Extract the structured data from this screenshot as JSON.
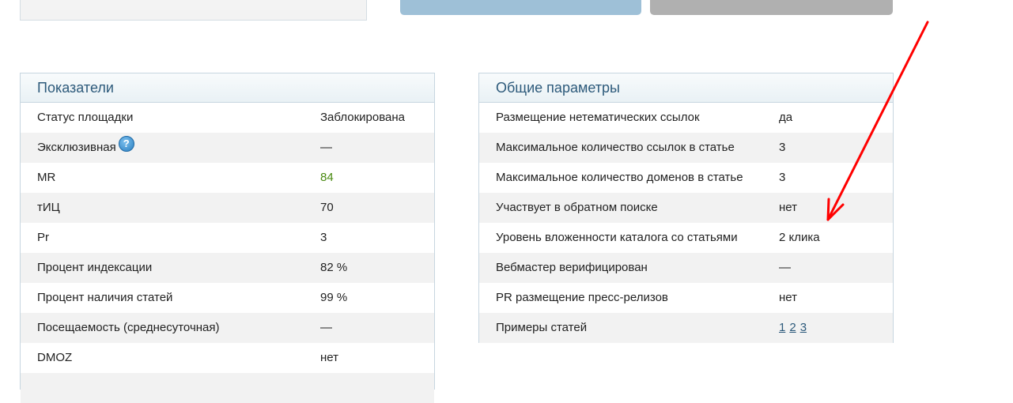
{
  "left_panel": {
    "title": "Показатели",
    "rows": [
      {
        "label": "Статус площадки",
        "value": "Заблокирована"
      },
      {
        "label": "Эксклюзивная",
        "value": "—"
      },
      {
        "label": "MR",
        "value": "84"
      },
      {
        "label": "тИЦ",
        "value": "70"
      },
      {
        "label": "Pr",
        "value": "3"
      },
      {
        "label": "Процент индексации",
        "value": "82 %"
      },
      {
        "label": "Процент наличия статей",
        "value": "99 %"
      },
      {
        "label": "Посещаемость (среднесуточная)",
        "value": "—"
      },
      {
        "label": "DMOZ",
        "value": "нет"
      }
    ],
    "help_icon_glyph": "?"
  },
  "right_panel": {
    "title": "Общие параметры",
    "rows": [
      {
        "label": "Размещение нетематических ссылок",
        "value": "да"
      },
      {
        "label": "Максимальное количество ссылок в статье",
        "value": "3"
      },
      {
        "label": "Максимальное количество доменов в статье",
        "value": "3"
      },
      {
        "label": "Участвует в обратном поиске",
        "value": "нет"
      },
      {
        "label": "Уровень вложенности каталога со статьями",
        "value": "2 клика"
      },
      {
        "label": "Вебмастер верифицирован",
        "value": "—"
      },
      {
        "label": "PR размещение пресс-релизов",
        "value": "нет"
      },
      {
        "label": "Примеры статей",
        "links": [
          "1",
          "2",
          "3"
        ]
      }
    ]
  },
  "colors": {
    "panel_title": "#2d5a7b",
    "mr_value": "#4a8a12",
    "annotation_arrow": "#ff0000"
  }
}
